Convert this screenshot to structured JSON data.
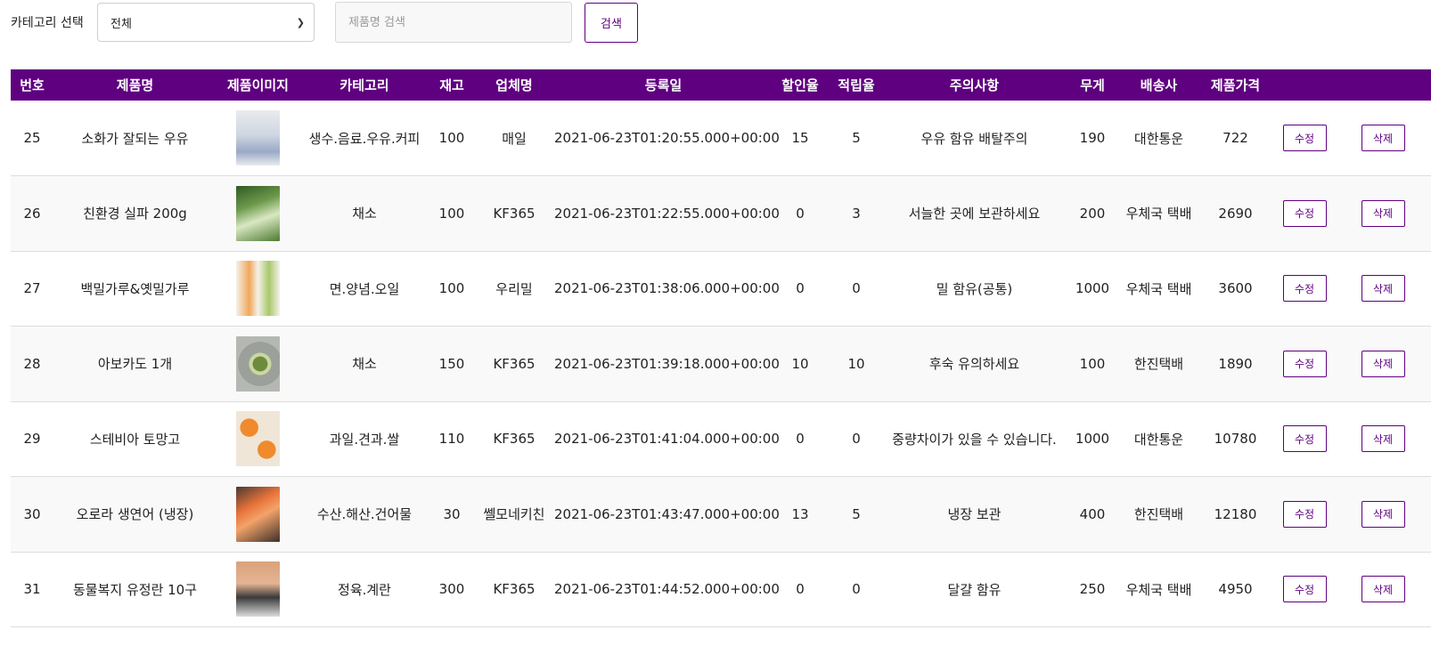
{
  "filter": {
    "category_label": "카테고리 선택",
    "category_selected": "전체",
    "search_placeholder": "제품명 검색",
    "search_button": "검색"
  },
  "colors": {
    "accent": "#5f0080"
  },
  "table": {
    "headers": [
      "번호",
      "제품명",
      "제품이미지",
      "카테고리",
      "재고",
      "업체명",
      "등록일",
      "할인율",
      "적립율",
      "주의사항",
      "무게",
      "배송사",
      "제품가격"
    ],
    "edit_label": "수정",
    "delete_label": "삭제",
    "rows": [
      {
        "no": "25",
        "name": "소화가 잘되는 우유",
        "category": "생수.음료.우유.커피",
        "stock": "100",
        "vendor": "매일",
        "date": "2021-06-23T01:20:55.000+00:00",
        "discount": "15",
        "points": "5",
        "caution": "우유 함유 배탈주의",
        "weight": "190",
        "courier": "대한통운",
        "price": "722"
      },
      {
        "no": "26",
        "name": "친환경 실파 200g",
        "category": "채소",
        "stock": "100",
        "vendor": "KF365",
        "date": "2021-06-23T01:22:55.000+00:00",
        "discount": "0",
        "points": "3",
        "caution": "서늘한 곳에 보관하세요",
        "weight": "200",
        "courier": "우체국 택배",
        "price": "2690"
      },
      {
        "no": "27",
        "name": "백밀가루&옛밀가루",
        "category": "면.양념.오일",
        "stock": "100",
        "vendor": "우리밀",
        "date": "2021-06-23T01:38:06.000+00:00",
        "discount": "0",
        "points": "0",
        "caution": "밀 함유(공통)",
        "weight": "1000",
        "courier": "우체국 택배",
        "price": "3600"
      },
      {
        "no": "28",
        "name": "아보카도 1개",
        "category": "채소",
        "stock": "150",
        "vendor": "KF365",
        "date": "2021-06-23T01:39:18.000+00:00",
        "discount": "10",
        "points": "10",
        "caution": "후숙 유의하세요",
        "weight": "100",
        "courier": "한진택배",
        "price": "1890"
      },
      {
        "no": "29",
        "name": "스테비아 토망고",
        "category": "과일.견과.쌀",
        "stock": "110",
        "vendor": "KF365",
        "date": "2021-06-23T01:41:04.000+00:00",
        "discount": "0",
        "points": "0",
        "caution": "중량차이가 있을 수 있습니다.",
        "weight": "1000",
        "courier": "대한통운",
        "price": "10780"
      },
      {
        "no": "30",
        "name": "오로라 생연어 (냉장)",
        "category": "수산.해산.건어물",
        "stock": "30",
        "vendor": "쎌모네키친",
        "date": "2021-06-23T01:43:47.000+00:00",
        "discount": "13",
        "points": "5",
        "caution": "냉장 보관",
        "weight": "400",
        "courier": "한진택배",
        "price": "12180"
      },
      {
        "no": "31",
        "name": "동물복지 유정란 10구",
        "category": "정육.계란",
        "stock": "300",
        "vendor": "KF365",
        "date": "2021-06-23T01:44:52.000+00:00",
        "discount": "0",
        "points": "0",
        "caution": "달걀 함유",
        "weight": "250",
        "courier": "우체국 택배",
        "price": "4950"
      }
    ]
  }
}
